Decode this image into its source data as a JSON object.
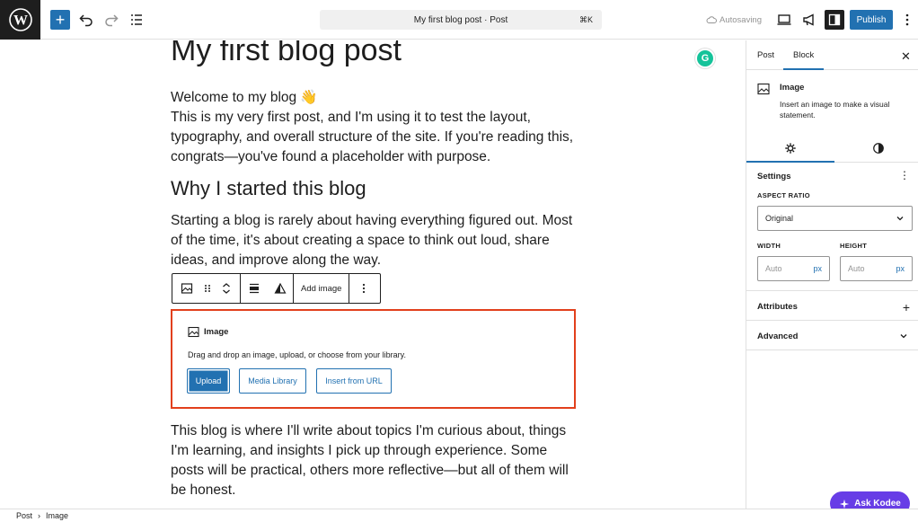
{
  "topbar": {
    "doc_title": "My first blog post · Post",
    "shortcut": "⌘K",
    "autosave_label": "Autosaving",
    "publish_label": "Publish",
    "add_symbol": "+",
    "icons": [
      "wordpress-logo-icon",
      "undo-icon",
      "redo-icon",
      "document-overview-icon",
      "preview-icon",
      "megaphone-icon",
      "settings-sidebar-icon",
      "more-options-icon"
    ]
  },
  "post": {
    "title": "My first blog post",
    "intro_line1": "Welcome to my blog 👋",
    "intro_rest": "This is my very first post, and I'm using it to test the layout, typography, and overall structure of the site. If you're reading this, congrats—you've found a placeholder with purpose.",
    "heading": "Why I started this blog",
    "para2": "Starting a blog is rarely about having everything figured out. Most of the time, it's about creating a space to think out loud, share ideas, and improve along the way.",
    "para3": "This blog is where I'll write about topics I'm curious about, things I'm learning, and insights I pick up through experience. Some posts will be practical, others more reflective—but all of them will be honest."
  },
  "block_toolbar": {
    "add_image_label": "Add image"
  },
  "image_block": {
    "title": "Image",
    "description": "Drag and drop an image, upload, or choose from your library.",
    "upload_label": "Upload",
    "media_library_label": "Media Library",
    "insert_url_label": "Insert from URL"
  },
  "sidebar": {
    "tab_post": "Post",
    "tab_block": "Block",
    "block_name": "Image",
    "block_desc": "Insert an image to make a visual statement.",
    "settings_title": "Settings",
    "aspect_ratio_label": "ASPECT RATIO",
    "aspect_ratio_value": "Original",
    "width_label": "WIDTH",
    "height_label": "HEIGHT",
    "width_placeholder": "Auto",
    "height_placeholder": "Auto",
    "unit": "px",
    "attributes_label": "Attributes",
    "advanced_label": "Advanced"
  },
  "footer": {
    "crumb_post": "Post",
    "crumb_sep": "›",
    "crumb_image": "Image"
  },
  "kodee": {
    "label": "Ask Kodee"
  },
  "colors": {
    "accent": "#2271b1",
    "selection_outline": "#e2401c",
    "kodee": "#673de6",
    "grammarly": "#15c39a"
  }
}
